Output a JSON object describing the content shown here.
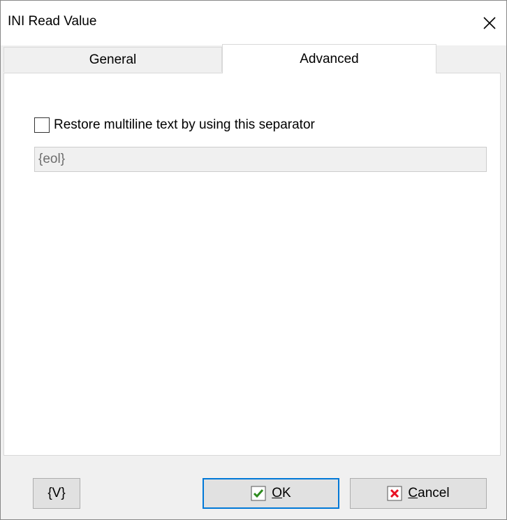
{
  "window": {
    "title": "INI Read Value"
  },
  "tabs": [
    {
      "label": "General",
      "active": false
    },
    {
      "label": "Advanced",
      "active": true
    }
  ],
  "advanced": {
    "multiline_checkbox": {
      "label": "Restore multiline text by using this separator",
      "checked": false
    },
    "separator_input": {
      "value": "{eol}",
      "enabled": false
    }
  },
  "buttons": {
    "variables_label": "{V}",
    "ok_mnemonic": "O",
    "ok_rest": "K",
    "cancel_mnemonic": "C",
    "cancel_rest": "ancel"
  },
  "colors": {
    "accent": "#0078d7",
    "ok_icon": "#2e8b1e",
    "cancel_icon": "#e81123"
  }
}
